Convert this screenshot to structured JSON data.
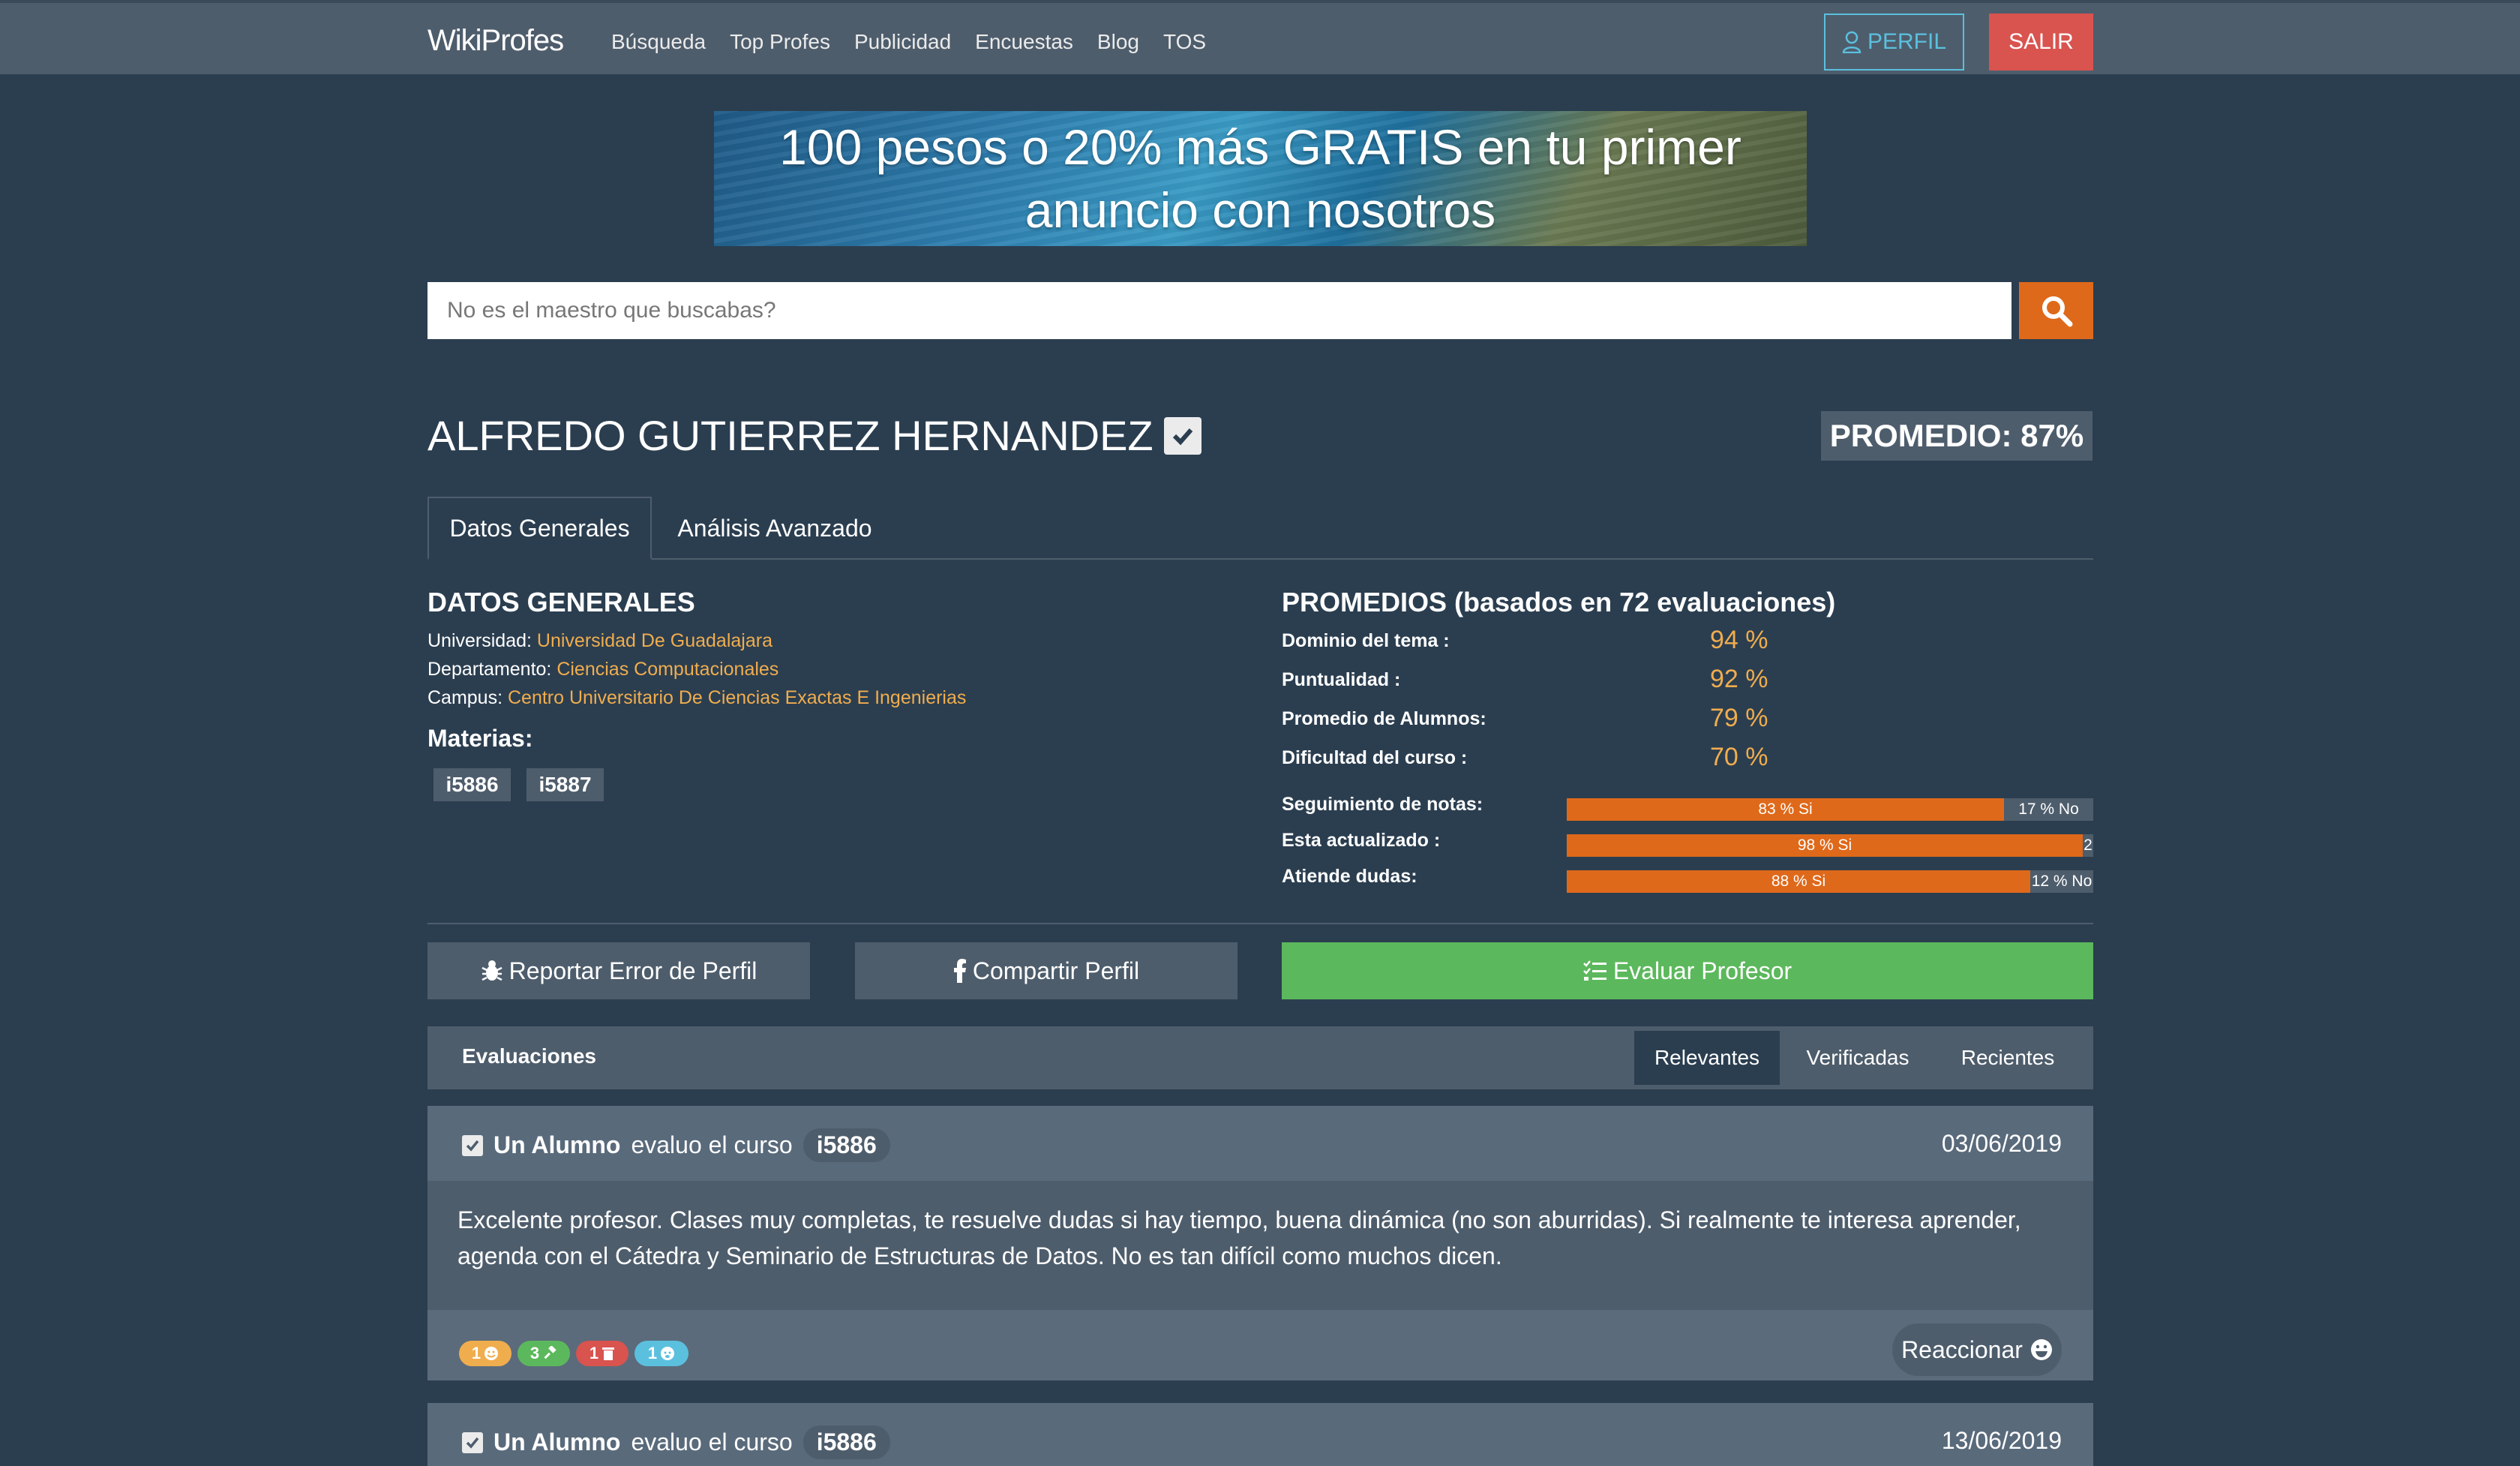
{
  "nav": {
    "brand": "WikiProfes",
    "links": [
      "Búsqueda",
      "Top Profes",
      "Publicidad",
      "Encuestas",
      "Blog",
      "TOS"
    ],
    "perfil_label": "PERFIL",
    "salir_label": "SALIR",
    "colors": {
      "perfil": "#5bc0de",
      "salir": "#d9534f",
      "bar": "#4e5d6c"
    }
  },
  "banner": {
    "line1": "100 pesos o 20% más GRATIS en tu primer",
    "line2": "anuncio con nosotros"
  },
  "search": {
    "placeholder": "No es el maestro que buscabas?",
    "button_icon": "search-icon",
    "button_color": "#df691a"
  },
  "profile": {
    "name": "ALFREDO GUTIERREZ HERNANDEZ",
    "verified_icon": "check-square-icon",
    "promedio": "PROMEDIO: 87%"
  },
  "tabs": [
    "Datos Generales",
    "Análisis Avanzado"
  ],
  "datos_generales": {
    "title": "DATOS GENERALES",
    "universidad_label": "Universidad:",
    "universidad": "Universidad De Guadalajara",
    "departamento_label": "Departamento:",
    "departamento": "Ciencias Computacionales",
    "campus_label": "Campus:",
    "campus": "Centro Universitario De Ciencias Exactas E Ingenierias",
    "materias_title": "Materias:",
    "materias": [
      "i5886",
      "i5887"
    ]
  },
  "promedios": {
    "title": "PROMEDIOS (basados en 72 evaluaciones)",
    "stats": [
      {
        "label": "Dominio del tema :",
        "value": "94 %"
      },
      {
        "label": "Puntualidad :",
        "value": "92 %"
      },
      {
        "label": "Promedio de Alumnos:",
        "value": "79 %"
      },
      {
        "label": "Dificultad del curso :",
        "value": "70 %"
      }
    ],
    "bars": [
      {
        "label": "Seguimiento de notas:",
        "yes_pct": 83,
        "yes_text": "83 % Si",
        "no_text": "17 % No"
      },
      {
        "label": "Esta actualizado :",
        "yes_pct": 98,
        "yes_text": "98 % Si",
        "no_text": "2"
      },
      {
        "label": "Atiende dudas:",
        "yes_pct": 88,
        "yes_text": "88 % Si",
        "no_text": "12 % No"
      }
    ]
  },
  "actions": {
    "reportar": "Reportar Error de Perfil",
    "compartir": "Compartir Perfil",
    "evaluar": "Evaluar Profesor"
  },
  "evaluaciones": {
    "title": "Evaluaciones",
    "filters": [
      "Relevantes",
      "Verificadas",
      "Recientes"
    ],
    "active_filter": "Relevantes",
    "reviews": [
      {
        "author": "Un Alumno",
        "action": "evaluo el curso",
        "course": "i5886",
        "date": "03/06/2019",
        "text": "Excelente profesor. Clases muy completas, te resuelve dudas si hay tiempo, buena dinámica (no son aburridas). Si realmente te interesa aprender, agenda con el Cátedra y Seminario de Estructuras de Datos. No es tan difícil como muchos dicen.",
        "reactions": [
          {
            "count": "1",
            "icon": "smile-icon",
            "color": "#f0ad4e"
          },
          {
            "count": "3",
            "icon": "gavel-icon",
            "color": "#5cb85c"
          },
          {
            "count": "1",
            "icon": "trash-icon",
            "color": "#d9534f"
          },
          {
            "count": "1",
            "icon": "angry-face-icon",
            "color": "#5bc0de"
          }
        ],
        "react_label": "Reaccionar"
      },
      {
        "author": "Un Alumno",
        "action": "evaluo el curso",
        "course": "i5886",
        "date": "13/06/2019"
      }
    ]
  }
}
